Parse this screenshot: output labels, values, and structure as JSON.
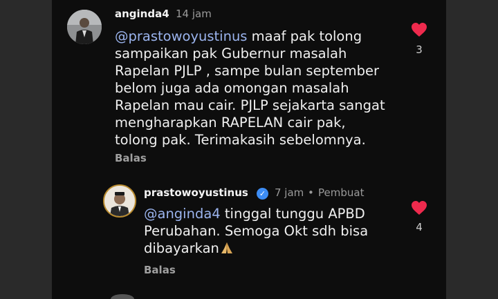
{
  "comment": {
    "username": "anginda4",
    "time": "14 jam",
    "mention": "@prastowoyustinus",
    "lines": [
      " maaf pak tolong",
      "sampaikan pak Gubernur masalah",
      "Rapelan PJLP , sampe bulan september",
      "belom juga ada omongan masalah",
      "Rapelan mau cair. PJLP sejakarta sangat",
      "mengharapkan RAPELAN cair pak,",
      "tolong pak. Terimakasih  sebelomnya."
    ],
    "reply_label": "Balas",
    "like_count": "3"
  },
  "reply": {
    "username": "prastowoyustinus",
    "time": "7 jam",
    "separator": "•",
    "creator_label": "Pembuat",
    "mention": "@anginda4",
    "lines": [
      " tinggal tunggu APBD",
      "Perubahan. Semoga Okt sdh bisa",
      "dibayarkan"
    ],
    "reply_label": "Balas",
    "like_count": "4"
  },
  "icons": {
    "heart": "heart-icon",
    "verified": "verified-badge-icon",
    "prayer": "folded-hands-emoji"
  },
  "colors": {
    "background": "#0d0d0d",
    "heart": "#ee2a4d",
    "mention": "#9bb4ee",
    "verified": "#3d8df5"
  }
}
